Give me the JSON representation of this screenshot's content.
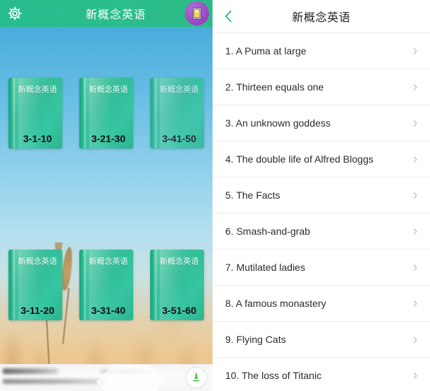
{
  "left": {
    "header": {
      "title": "新概念英语",
      "gear_icon": "gear-icon",
      "book_badge_icon": "book-badge-icon"
    },
    "books": [
      {
        "title": "新概念英语",
        "range": "3-1-10"
      },
      {
        "title": "新概念英语",
        "range": "3-21-30"
      },
      {
        "title": "新概念英语",
        "range": "3-41-50"
      },
      {
        "title": "新概念英语",
        "range": "3-11-20"
      },
      {
        "title": "新概念英语",
        "range": "3-31-40"
      },
      {
        "title": "新概念英语",
        "range": "3-51-60"
      }
    ],
    "player": {
      "knob_icon": "download-icon"
    }
  },
  "right": {
    "header": {
      "back_icon": "back-chevron-icon",
      "title": "新概念英语"
    },
    "lessons": [
      {
        "label": "1. A Puma at large"
      },
      {
        "label": "2. Thirteen equals one"
      },
      {
        "label": "3. An unknown goddess"
      },
      {
        "label": "4. The double life of Alfred Bloggs"
      },
      {
        "label": "5. The Facts"
      },
      {
        "label": "6. Smash-and-grab"
      },
      {
        "label": "7. Mutilated ladies"
      },
      {
        "label": "8. A famous monastery"
      },
      {
        "label": "9. Flying Cats"
      },
      {
        "label": "10. The loss of Titanic"
      }
    ],
    "chevron_icon": "chevron-right-icon"
  },
  "colors": {
    "header_green": "#2bbd8a",
    "sky_blue": "#3fa9dc",
    "book_teal": "#2fbb95",
    "badge_purple": "#9b3fc4",
    "accent_green": "#3fb93f"
  }
}
